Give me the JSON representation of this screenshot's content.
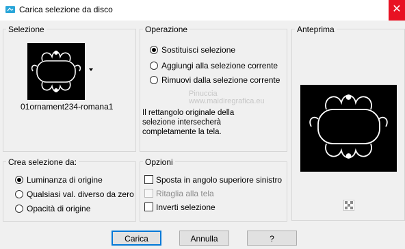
{
  "window": {
    "title": "Carica selezione da disco",
    "close_symbol": "✕"
  },
  "selezione": {
    "label": "Selezione",
    "filename": "01ornament234-romana1"
  },
  "operazione": {
    "label": "Operazione",
    "options": [
      "Sostituisci selezione",
      "Aggiungi alla selezione corrente",
      "Rimuovi dalla selezione corrente"
    ],
    "selected_index": 0,
    "info": [
      "Il rettangolo originale della",
      "selezione intersecherà",
      "completamente la tela."
    ]
  },
  "anteprima": {
    "label": "Anteprima"
  },
  "crea": {
    "label": "Crea selezione da:",
    "options": [
      "Luminanza di origine",
      "Qualsiasi val. diverso da zero",
      "Opacità di origine"
    ],
    "selected_index": 0
  },
  "opzioni": {
    "label": "Opzioni",
    "items": [
      {
        "text": "Sposta in angolo superiore sinistro",
        "checked": false,
        "disabled": false
      },
      {
        "text": "Ritaglia alla tela",
        "checked": false,
        "disabled": true
      },
      {
        "text": "Inverti selezione",
        "checked": false,
        "disabled": false
      }
    ]
  },
  "buttons": {
    "ok": "Carica",
    "cancel": "Annulla",
    "help": "?"
  },
  "watermark": {
    "line1": "www.maidiregrafica.eu",
    "line2": "Pinuccia"
  }
}
